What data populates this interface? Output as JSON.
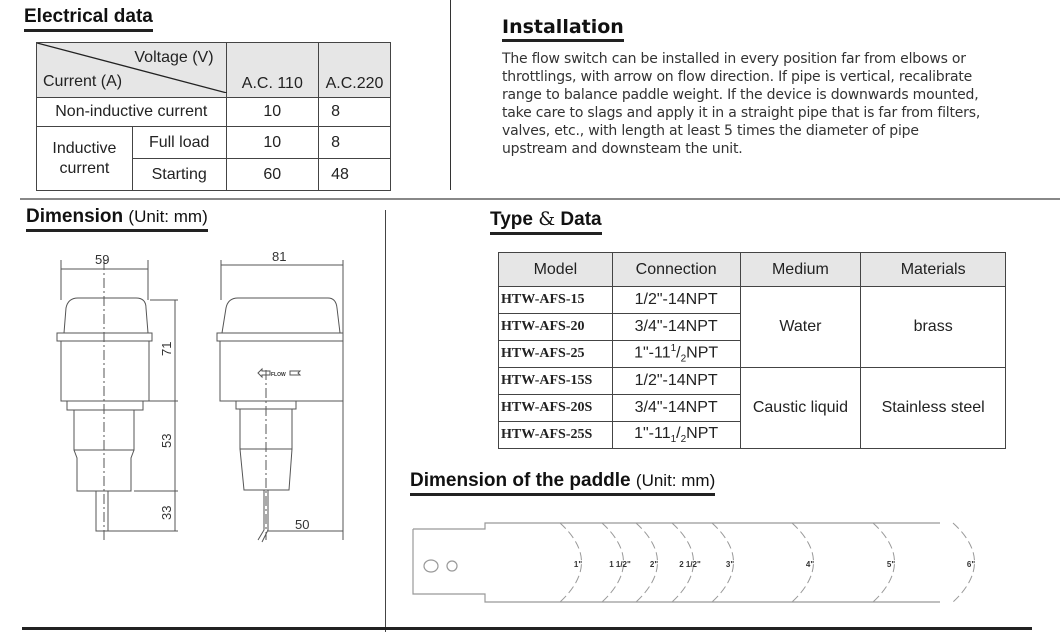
{
  "electrical": {
    "title": "Electrical data",
    "header": {
      "voltage_label": "Voltage (V)",
      "current_label": "Current (A)",
      "col1": "A.C. 110",
      "col2": "A.C.220"
    },
    "rows": {
      "non_inductive": {
        "label": "Non-inductive current",
        "ac110": "10",
        "ac220": "8"
      },
      "inductive_label": "Inductive current",
      "full_load": {
        "label": "Full load",
        "ac110": "10",
        "ac220": "8"
      },
      "starting": {
        "label": "Starting",
        "ac110": "60",
        "ac220": "48"
      }
    }
  },
  "installation": {
    "title": "Installation",
    "text": "The flow switch can be installed in every position far from elbows or throttlings, with arrow on flow direction. If pipe is vertical, recalibrate range to balance paddle weight. If the device is downwards mounted, take care to slags and apply it in a straight pipe that is far from filters, valves, etc., with length at least 5 times the diameter of pipe upstream and downsteam the unit."
  },
  "dimension": {
    "title": "Dimension",
    "unit": "(Unit: mm)",
    "front": {
      "width": "59",
      "height_top": "71",
      "height_mid": "53",
      "height_bottom": "33"
    },
    "side": {
      "width": "81",
      "paddle": "50",
      "flow_label": "FLOW"
    }
  },
  "type_data": {
    "title_a": "Type",
    "title_amp": "&",
    "title_b": "Data",
    "headers": [
      "Model",
      "Connection",
      "Medium",
      "Materials"
    ],
    "rows": [
      {
        "model": "HTW-AFS-15",
        "conn_main": "1/2\"-14NPT"
      },
      {
        "model": "HTW-AFS-20",
        "conn_main": "3/4\"-14NPT"
      },
      {
        "model": "HTW-AFS-25",
        "conn_pre": "1\"-11",
        "conn_sup": "1",
        "conn_sub": "2",
        "conn_post": "NPT"
      },
      {
        "model": "HTW-AFS-15S",
        "conn_main": "1/2\"-14NPT"
      },
      {
        "model": "HTW-AFS-20S",
        "conn_main": "3/4\"-14NPT"
      },
      {
        "model": "HTW-AFS-25S",
        "conn_pre": "1\"-11",
        "conn_sub1": "1",
        "conn_mid": "/",
        "conn_sub2": "2",
        "conn_post": "NPT"
      }
    ],
    "groups": [
      {
        "medium": "Water",
        "material": "brass"
      },
      {
        "medium": "Caustic liquid",
        "material": "Stainless steel"
      }
    ]
  },
  "paddle": {
    "title": "Dimension of the paddle",
    "unit": "(Unit: mm)",
    "sizes": [
      "1\"",
      "1 1/2\"",
      "2\"",
      "2 1/2\"",
      "3\"",
      "4\"",
      "5\"",
      "6\""
    ]
  }
}
